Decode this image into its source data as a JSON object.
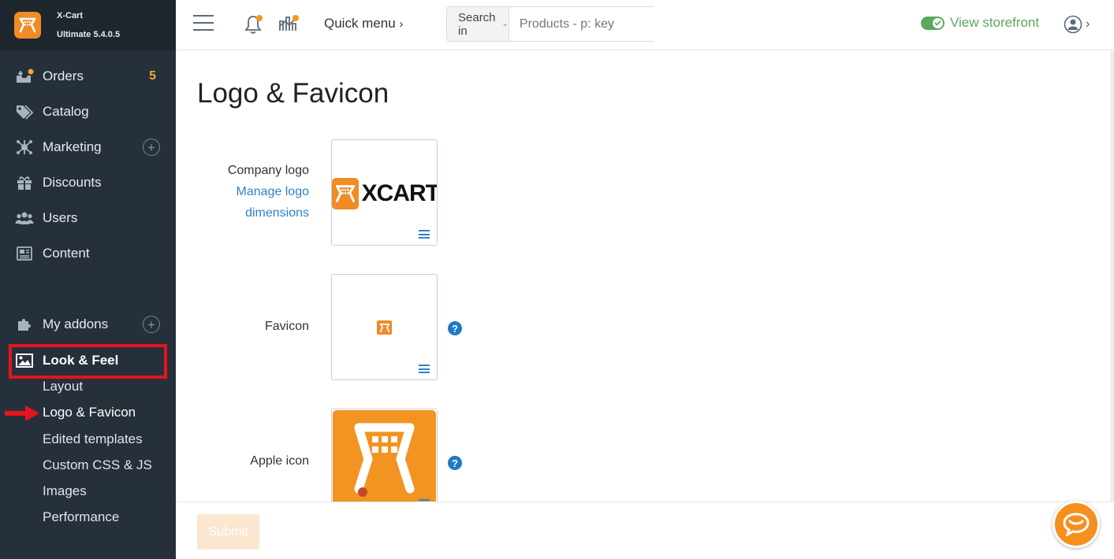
{
  "brand": {
    "name": "X-Cart",
    "version": "Ultimate 5.4.0.5"
  },
  "sidebar": {
    "items": [
      {
        "label": "Orders",
        "badge": "5",
        "icon": "orders-icon"
      },
      {
        "label": "Catalog",
        "icon": "tags-icon"
      },
      {
        "label": "Marketing",
        "icon": "marketing-icon"
      },
      {
        "label": "Discounts",
        "icon": "gift-icon"
      },
      {
        "label": "Users",
        "icon": "users-icon"
      },
      {
        "label": "Content",
        "icon": "newspaper-icon"
      },
      {
        "label": "My addons",
        "icon": "puzzle-icon"
      },
      {
        "label": "Look & Feel",
        "icon": "image-icon"
      }
    ],
    "look_feel_sub": [
      "Layout",
      "Logo & Favicon",
      "Edited templates",
      "Custom CSS & JS",
      "Images",
      "Performance"
    ]
  },
  "header": {
    "quick_menu": "Quick menu",
    "search_in": "Search in",
    "search_placeholder": "Products - p: key",
    "view_storefront": "View storefront"
  },
  "main": {
    "title": "Logo & Favicon",
    "company_logo_label": "Company logo",
    "manage_logo_line1": "Manage logo",
    "manage_logo_line2": "dimensions",
    "company_logo_text": "XCART",
    "favicon_label": "Favicon",
    "apple_icon_label": "Apple icon"
  },
  "footer": {
    "submit_label": "Submit"
  },
  "colors": {
    "accent": "#f08b26",
    "sidebar_bg": "#26303a",
    "link": "#2f83c5",
    "storefront_green": "#5ca85c",
    "highlight_red": "#e5141c"
  }
}
